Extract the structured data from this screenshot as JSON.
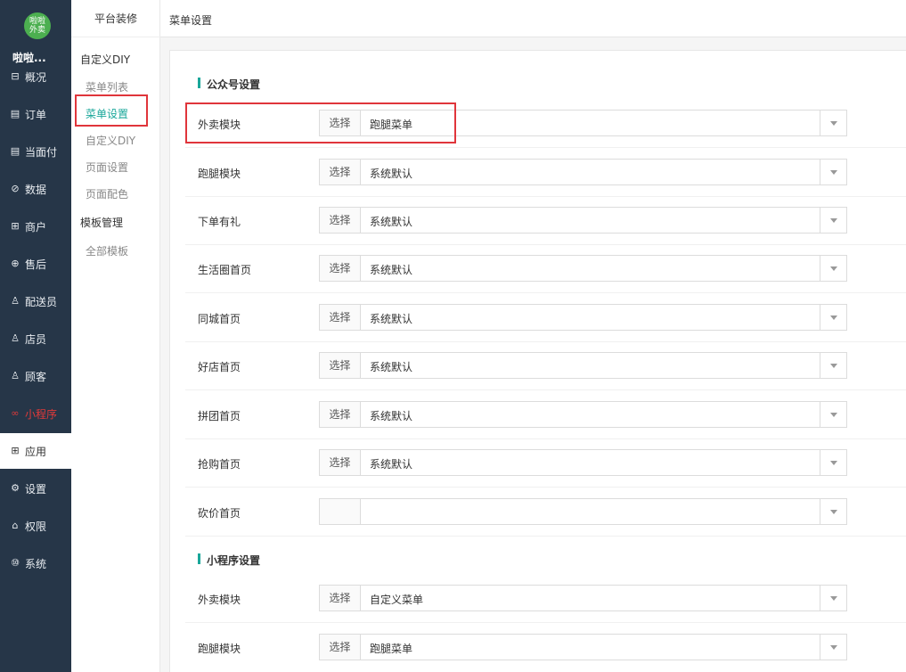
{
  "logo": {
    "line1": "啦啦",
    "line2": "外卖"
  },
  "brand": "啦啦...",
  "nav": [
    {
      "label": "概况",
      "icon": "overview-icon",
      "glyph": "⊟"
    },
    {
      "label": "订单",
      "icon": "order-icon",
      "glyph": "▤"
    },
    {
      "label": "当面付",
      "icon": "pay-icon",
      "glyph": "▤"
    },
    {
      "label": "数据",
      "icon": "data-icon",
      "glyph": "⊘"
    },
    {
      "label": "商户",
      "icon": "shop-icon",
      "glyph": "⊞"
    },
    {
      "label": "售后",
      "icon": "aftersale-icon",
      "glyph": "⊕"
    },
    {
      "label": "配送员",
      "icon": "courier-icon",
      "glyph": "♙"
    },
    {
      "label": "店员",
      "icon": "clerk-icon",
      "glyph": "♙"
    },
    {
      "label": "顾客",
      "icon": "customer-icon",
      "glyph": "♙"
    },
    {
      "label": "小程序",
      "icon": "miniapp-icon",
      "glyph": "∞"
    },
    {
      "label": "应用",
      "icon": "apps-icon",
      "glyph": "⊞"
    },
    {
      "label": "设置",
      "icon": "settings-icon",
      "glyph": "⚙"
    },
    {
      "label": "权限",
      "icon": "lock-icon",
      "glyph": "⌂"
    },
    {
      "label": "系统",
      "icon": "system-icon",
      "glyph": "⑩"
    }
  ],
  "subnav": {
    "head": "平台装修",
    "sec1": "自定义DIY",
    "menu_list": "菜单列表",
    "menu_settings": "菜单设置",
    "custom_diy": "自定义DIY",
    "page_settings": "页面设置",
    "page_colors": "页面配色",
    "sec2": "模板管理",
    "all_templates": "全部模板"
  },
  "topbar": {
    "title": "菜单设置"
  },
  "sections": {
    "wechat": "公众号设置",
    "miniprogram": "小程序设置"
  },
  "select_button": "选择",
  "rows": [
    {
      "label": "外卖模块",
      "value": "跑腿菜单"
    },
    {
      "label": "跑腿模块",
      "value": "系统默认"
    },
    {
      "label": "下单有礼",
      "value": "系统默认"
    },
    {
      "label": "生活圈首页",
      "value": "系统默认"
    },
    {
      "label": "同城首页",
      "value": "系统默认"
    },
    {
      "label": "好店首页",
      "value": "系统默认"
    },
    {
      "label": "拼团首页",
      "value": "系统默认"
    },
    {
      "label": "抢购首页",
      "value": "系统默认"
    },
    {
      "label": "砍价首页",
      "value": ""
    },
    {
      "label": "外卖模块",
      "value": "自定义菜单"
    },
    {
      "label": "跑腿模块",
      "value": "跑腿菜单"
    }
  ],
  "colors": {
    "accent": "#1aa79a",
    "highlight": "#e0353b",
    "sidebar": "#263648"
  }
}
